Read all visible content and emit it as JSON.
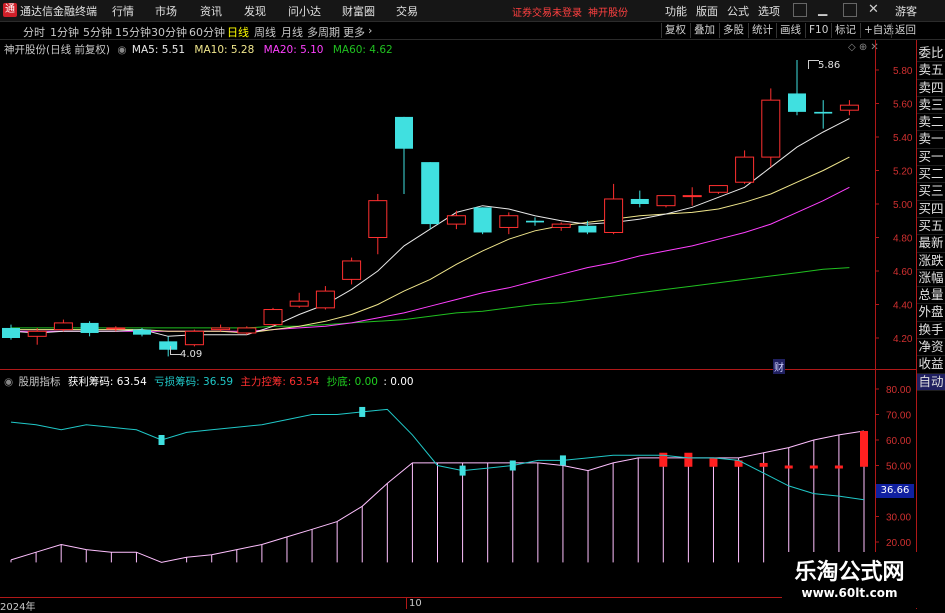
{
  "titlebar": {
    "app_name": "通达信金融终端",
    "menus": [
      "行情",
      "市场",
      "资讯",
      "发现",
      "问小达",
      "财富圈",
      "交易"
    ],
    "notice": "证券交易未登录",
    "stock_name": "神开股份",
    "right_menus": [
      "功能",
      "版面",
      "公式",
      "选项"
    ],
    "guest": "游客"
  },
  "toolbar": {
    "periods": [
      "分时",
      "1分钟",
      "5分钟",
      "15分钟",
      "30分钟",
      "60分钟",
      "日线",
      "周线",
      "月线",
      "多周期",
      "更多"
    ],
    "active_period": "日线",
    "right_buttons": [
      "复权",
      "叠加",
      "多股",
      "统计",
      "画线",
      "F10",
      "标记",
      "+自选",
      "返回"
    ]
  },
  "main_chart": {
    "title": "神开股份(日线 前复权)",
    "ma": [
      {
        "label": "MA5: 5.51",
        "color": "#e8e8e8"
      },
      {
        "label": "MA10: 5.28",
        "color": "#f0e68c"
      },
      {
        "label": "MA20: 5.10",
        "color": "#ff40ff"
      },
      {
        "label": "MA60: 4.62",
        "color": "#20c020"
      }
    ],
    "y_ticks": [
      "5.80",
      "5.60",
      "5.40",
      "5.20",
      "5.00",
      "4.80",
      "4.60",
      "4.40",
      "4.20"
    ],
    "high_label": "5.86",
    "low_label": "4.09",
    "cai_label": "财"
  },
  "indicator": {
    "name": "股朋指标",
    "items": [
      {
        "label": "获利筹码: 63.54",
        "color": "#ffffff"
      },
      {
        "label": "亏损筹码: 36.59",
        "color": "#20c8c8"
      },
      {
        "label": "主力控筹: 63.54",
        "color": "#ff3030"
      },
      {
        "label": "抄底: 0.00",
        "color": "#20d020"
      },
      {
        "label": ": 0.00",
        "color": "#ffffff"
      }
    ],
    "y_ticks": [
      "80.00",
      "70.00",
      "60.00",
      "50.00",
      "40.00",
      "30.00",
      "20.00"
    ],
    "current_value": "36.66"
  },
  "date_axis": {
    "labels": [
      "2024年",
      "10"
    ]
  },
  "side_panel": {
    "items": [
      "委比",
      "卖五",
      "卖四",
      "卖三",
      "卖二",
      "卖一",
      "买一",
      "买二",
      "买三",
      "买四",
      "买五",
      "最新",
      "涨跌",
      "涨幅",
      "总量",
      "外盘",
      "换手",
      "净资",
      "收益",
      "自动"
    ]
  },
  "watermark": {
    "title": "乐淘公式网",
    "url": "www.60lt.com"
  },
  "colors": {
    "up": "#ff3030",
    "down": "#40e0e0",
    "axis": "#b01818",
    "bg": "#000000"
  },
  "chart_data": {
    "type": "candlestick",
    "price_candles": [
      {
        "o": 4.26,
        "h": 4.28,
        "l": 4.19,
        "c": 4.2
      },
      {
        "o": 4.21,
        "h": 4.26,
        "l": 4.16,
        "c": 4.24
      },
      {
        "o": 4.25,
        "h": 4.31,
        "l": 4.24,
        "c": 4.29
      },
      {
        "o": 4.29,
        "h": 4.3,
        "l": 4.21,
        "c": 4.23
      },
      {
        "o": 4.26,
        "h": 4.27,
        "l": 4.24,
        "c": 4.26
      },
      {
        "o": 4.25,
        "h": 4.26,
        "l": 4.21,
        "c": 4.22
      },
      {
        "o": 4.18,
        "h": 4.21,
        "l": 4.09,
        "c": 4.13
      },
      {
        "o": 4.16,
        "h": 4.25,
        "l": 4.15,
        "c": 4.24
      },
      {
        "o": 4.25,
        "h": 4.28,
        "l": 4.24,
        "c": 4.26
      },
      {
        "o": 4.23,
        "h": 4.27,
        "l": 4.22,
        "c": 4.26
      },
      {
        "o": 4.28,
        "h": 4.38,
        "l": 4.27,
        "c": 4.37
      },
      {
        "o": 4.39,
        "h": 4.47,
        "l": 4.38,
        "c": 4.42
      },
      {
        "o": 4.38,
        "h": 4.51,
        "l": 4.37,
        "c": 4.48
      },
      {
        "o": 4.55,
        "h": 4.68,
        "l": 4.52,
        "c": 4.66
      },
      {
        "o": 4.8,
        "h": 5.06,
        "l": 4.7,
        "c": 5.02
      },
      {
        "o": 5.52,
        "h": 5.52,
        "l": 5.06,
        "c": 5.33
      },
      {
        "o": 5.25,
        "h": 5.25,
        "l": 4.85,
        "c": 4.88
      },
      {
        "o": 4.88,
        "h": 4.96,
        "l": 4.85,
        "c": 4.93
      },
      {
        "o": 4.98,
        "h": 4.98,
        "l": 4.82,
        "c": 4.83
      },
      {
        "o": 4.86,
        "h": 4.95,
        "l": 4.82,
        "c": 4.93
      },
      {
        "o": 4.9,
        "h": 4.92,
        "l": 4.87,
        "c": 4.89
      },
      {
        "o": 4.86,
        "h": 4.89,
        "l": 4.84,
        "c": 4.88
      },
      {
        "o": 4.87,
        "h": 4.9,
        "l": 4.82,
        "c": 4.83
      },
      {
        "o": 4.83,
        "h": 5.12,
        "l": 4.82,
        "c": 5.03
      },
      {
        "o": 5.03,
        "h": 5.08,
        "l": 4.98,
        "c": 5.0
      },
      {
        "o": 4.99,
        "h": 5.05,
        "l": 4.98,
        "c": 5.05
      },
      {
        "o": 5.05,
        "h": 5.1,
        "l": 4.99,
        "c": 5.05
      },
      {
        "o": 5.07,
        "h": 5.11,
        "l": 5.06,
        "c": 5.11
      },
      {
        "o": 5.13,
        "h": 5.32,
        "l": 5.12,
        "c": 5.28
      },
      {
        "o": 5.28,
        "h": 5.69,
        "l": 5.22,
        "c": 5.62
      },
      {
        "o": 5.66,
        "h": 5.86,
        "l": 5.53,
        "c": 5.55
      },
      {
        "o": 5.55,
        "h": 5.62,
        "l": 5.45,
        "c": 5.54
      },
      {
        "o": 5.56,
        "h": 5.62,
        "l": 5.53,
        "c": 5.59
      }
    ],
    "ma5": [
      4.24,
      4.23,
      4.24,
      4.24,
      4.24,
      4.25,
      4.21,
      4.22,
      4.22,
      4.22,
      4.27,
      4.34,
      4.4,
      4.49,
      4.6,
      4.75,
      4.85,
      4.95,
      4.99,
      4.97,
      4.93,
      4.9,
      4.88,
      4.89,
      4.91,
      4.94,
      4.98,
      5.04,
      5.1,
      5.22,
      5.34,
      5.43,
      5.51
    ],
    "ma10": [
      4.25,
      4.25,
      4.25,
      4.25,
      4.25,
      4.25,
      4.24,
      4.24,
      4.24,
      4.23,
      4.25,
      4.27,
      4.3,
      4.34,
      4.4,
      4.48,
      4.55,
      4.64,
      4.72,
      4.79,
      4.84,
      4.87,
      4.89,
      4.91,
      4.93,
      4.94,
      4.95,
      4.97,
      5.01,
      5.06,
      5.13,
      5.2,
      5.28
    ],
    "ma20": [
      4.24,
      4.24,
      4.24,
      4.24,
      4.24,
      4.24,
      4.24,
      4.24,
      4.24,
      4.24,
      4.25,
      4.26,
      4.27,
      4.29,
      4.32,
      4.35,
      4.39,
      4.43,
      4.47,
      4.5,
      4.54,
      4.58,
      4.62,
      4.65,
      4.69,
      4.72,
      4.75,
      4.79,
      4.83,
      4.88,
      4.95,
      5.02,
      5.1
    ],
    "ma60": [
      4.26,
      4.26,
      4.26,
      4.26,
      4.26,
      4.26,
      4.26,
      4.26,
      4.26,
      4.26,
      4.27,
      4.27,
      4.28,
      4.29,
      4.3,
      4.31,
      4.33,
      4.35,
      4.36,
      4.38,
      4.4,
      4.41,
      4.43,
      4.45,
      4.47,
      4.49,
      4.51,
      4.53,
      4.55,
      4.57,
      4.59,
      4.61,
      4.62
    ],
    "price_ylim": [
      4.09,
      5.86
    ],
    "profit_chips": [
      13,
      16,
      19,
      17,
      16,
      16,
      12,
      14,
      15,
      17,
      19,
      22,
      25,
      28,
      34,
      43,
      51,
      51,
      51,
      51,
      51,
      51,
      50,
      48,
      51,
      53,
      53,
      53,
      53,
      53,
      55,
      57,
      60,
      62,
      63.54
    ],
    "loss_chips": [
      67,
      66,
      64,
      66,
      65,
      64,
      60,
      63,
      64,
      65,
      66,
      68,
      70,
      70,
      71,
      72,
      62,
      50,
      48,
      49,
      50,
      52,
      52,
      53,
      54,
      54,
      54,
      53,
      53,
      52,
      47,
      42,
      39,
      38,
      36.59
    ],
    "main_control": [
      0,
      0,
      0,
      0,
      0,
      0,
      0,
      0,
      0,
      0,
      0,
      0,
      0,
      0,
      0,
      0,
      0,
      0,
      0,
      0,
      0,
      0,
      0,
      0,
      0,
      0,
      55,
      55,
      53,
      52,
      51,
      49,
      48,
      47,
      63.54
    ],
    "indicator_ylim": [
      12,
      84
    ]
  }
}
